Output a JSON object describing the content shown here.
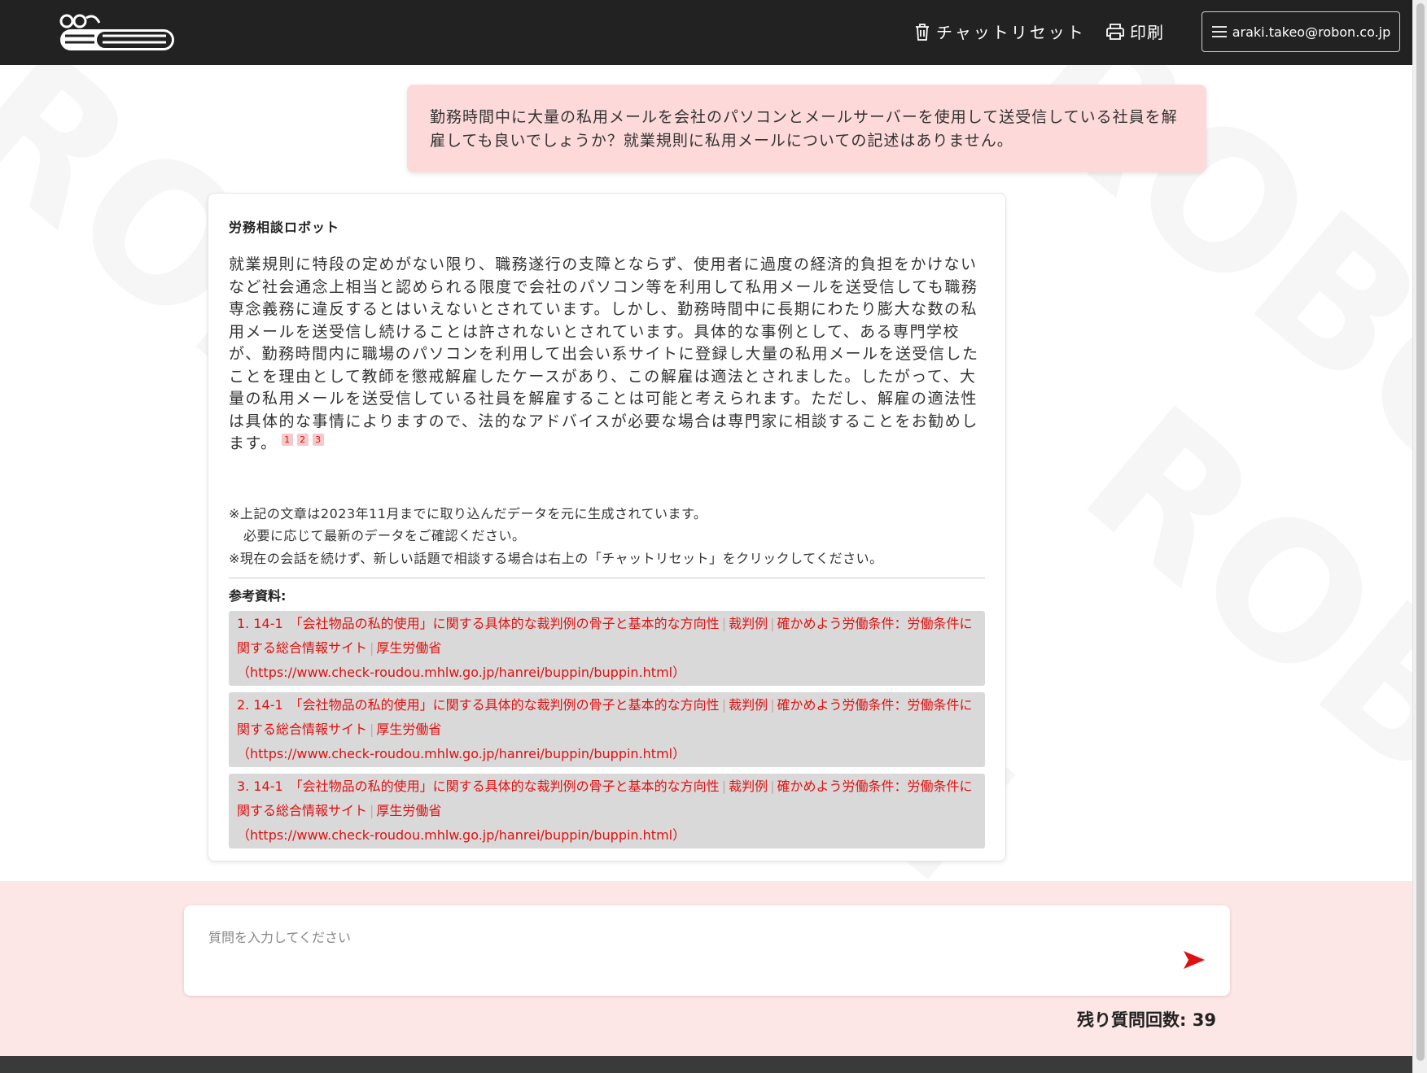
{
  "header": {
    "logo_alt": "労務相談ロボット",
    "reset_label": "チャットリセット",
    "print_label": "印刷",
    "user_email": "araki.takeo@robon.co.jp"
  },
  "colors": {
    "header_bg": "#222222",
    "user_bubble_bg": "#fdd9d9",
    "input_area_bg": "#fde6e6",
    "accent_red": "#e01010",
    "reference_bg": "#d9d9d9"
  },
  "chat": {
    "user_message": "勤務時間中に大量の私用メールを会社のパソコンとメールサーバーを使用して送受信している社員を解雇しても良いでしょうか？就業規則に私用メールについての記述はありません。",
    "bot_name": "労務相談ロボット",
    "bot_answer": "就業規則に特段の定めがない限り、職務遂行の支障とならず、使用者に過度の経済的負担をかけないなど社会通念上相当と認められる限度で会社のパソコン等を利用して私用メールを送受信しても職務専念義務に違反するとはいえないとされています。しかし、勤務時間中に長期にわたり膨大な数の私用メールを送受信し続けることは許されないとされています。具体的な事例として、ある専門学校が、勤務時間内に職場のパソコンを利用して出会い系サイトに登録し大量の私用メールを送受信したことを理由として教師を懲戒解雇したケースがあり、この解雇は適法とされました。したがって、大量の私用メールを送受信している社員を解雇することは可能と考えられます。ただし、解雇の適法性は具体的な事情によりますので、法的なアドバイスが必要な場合は専門家に相談することをお勧めします。",
    "citations": [
      "1",
      "2",
      "3"
    ],
    "note_line1": "※上記の文章は2023年11月までに取り込んだデータを元に生成されています。",
    "note_line2": "必要に応じて最新のデータをご確認ください。",
    "note_line3": "※現在の会話を続けず、新しい話題で相談する場合は右上の「チャットリセット」をクリックしてください。",
    "references_title": "参考資料:",
    "references": [
      {
        "num": "1.",
        "title": "14-1　「会社物品の私的使用」に関する具体的な裁判例の骨子と基本的な方向性",
        "seg2": "裁判例",
        "seg3": "確かめよう労働条件：労働条件に関する総合情報サイト",
        "seg4": "厚生労働省",
        "url": "（https://www.check-roudou.mhlw.go.jp/hanrei/buppin/buppin.html）"
      },
      {
        "num": "2.",
        "title": "14-1　「会社物品の私的使用」に関する具体的な裁判例の骨子と基本的な方向性",
        "seg2": "裁判例",
        "seg3": "確かめよう労働条件：労働条件に関する総合情報サイト",
        "seg4": "厚生労働省",
        "url": "（https://www.check-roudou.mhlw.go.jp/hanrei/buppin/buppin.html）"
      },
      {
        "num": "3.",
        "title": "14-1　「会社物品の私的使用」に関する具体的な裁判例の骨子と基本的な方向性",
        "seg2": "裁判例",
        "seg3": "確かめよう労働条件：労働条件に関する総合情報サイト",
        "seg4": "厚生労働省",
        "url": "（https://www.check-roudou.mhlw.go.jp/hanrei/buppin/buppin.html）"
      }
    ]
  },
  "input": {
    "placeholder": "質問を入力してください",
    "remaining_label": "残り質問回数:",
    "remaining_count": "39"
  }
}
